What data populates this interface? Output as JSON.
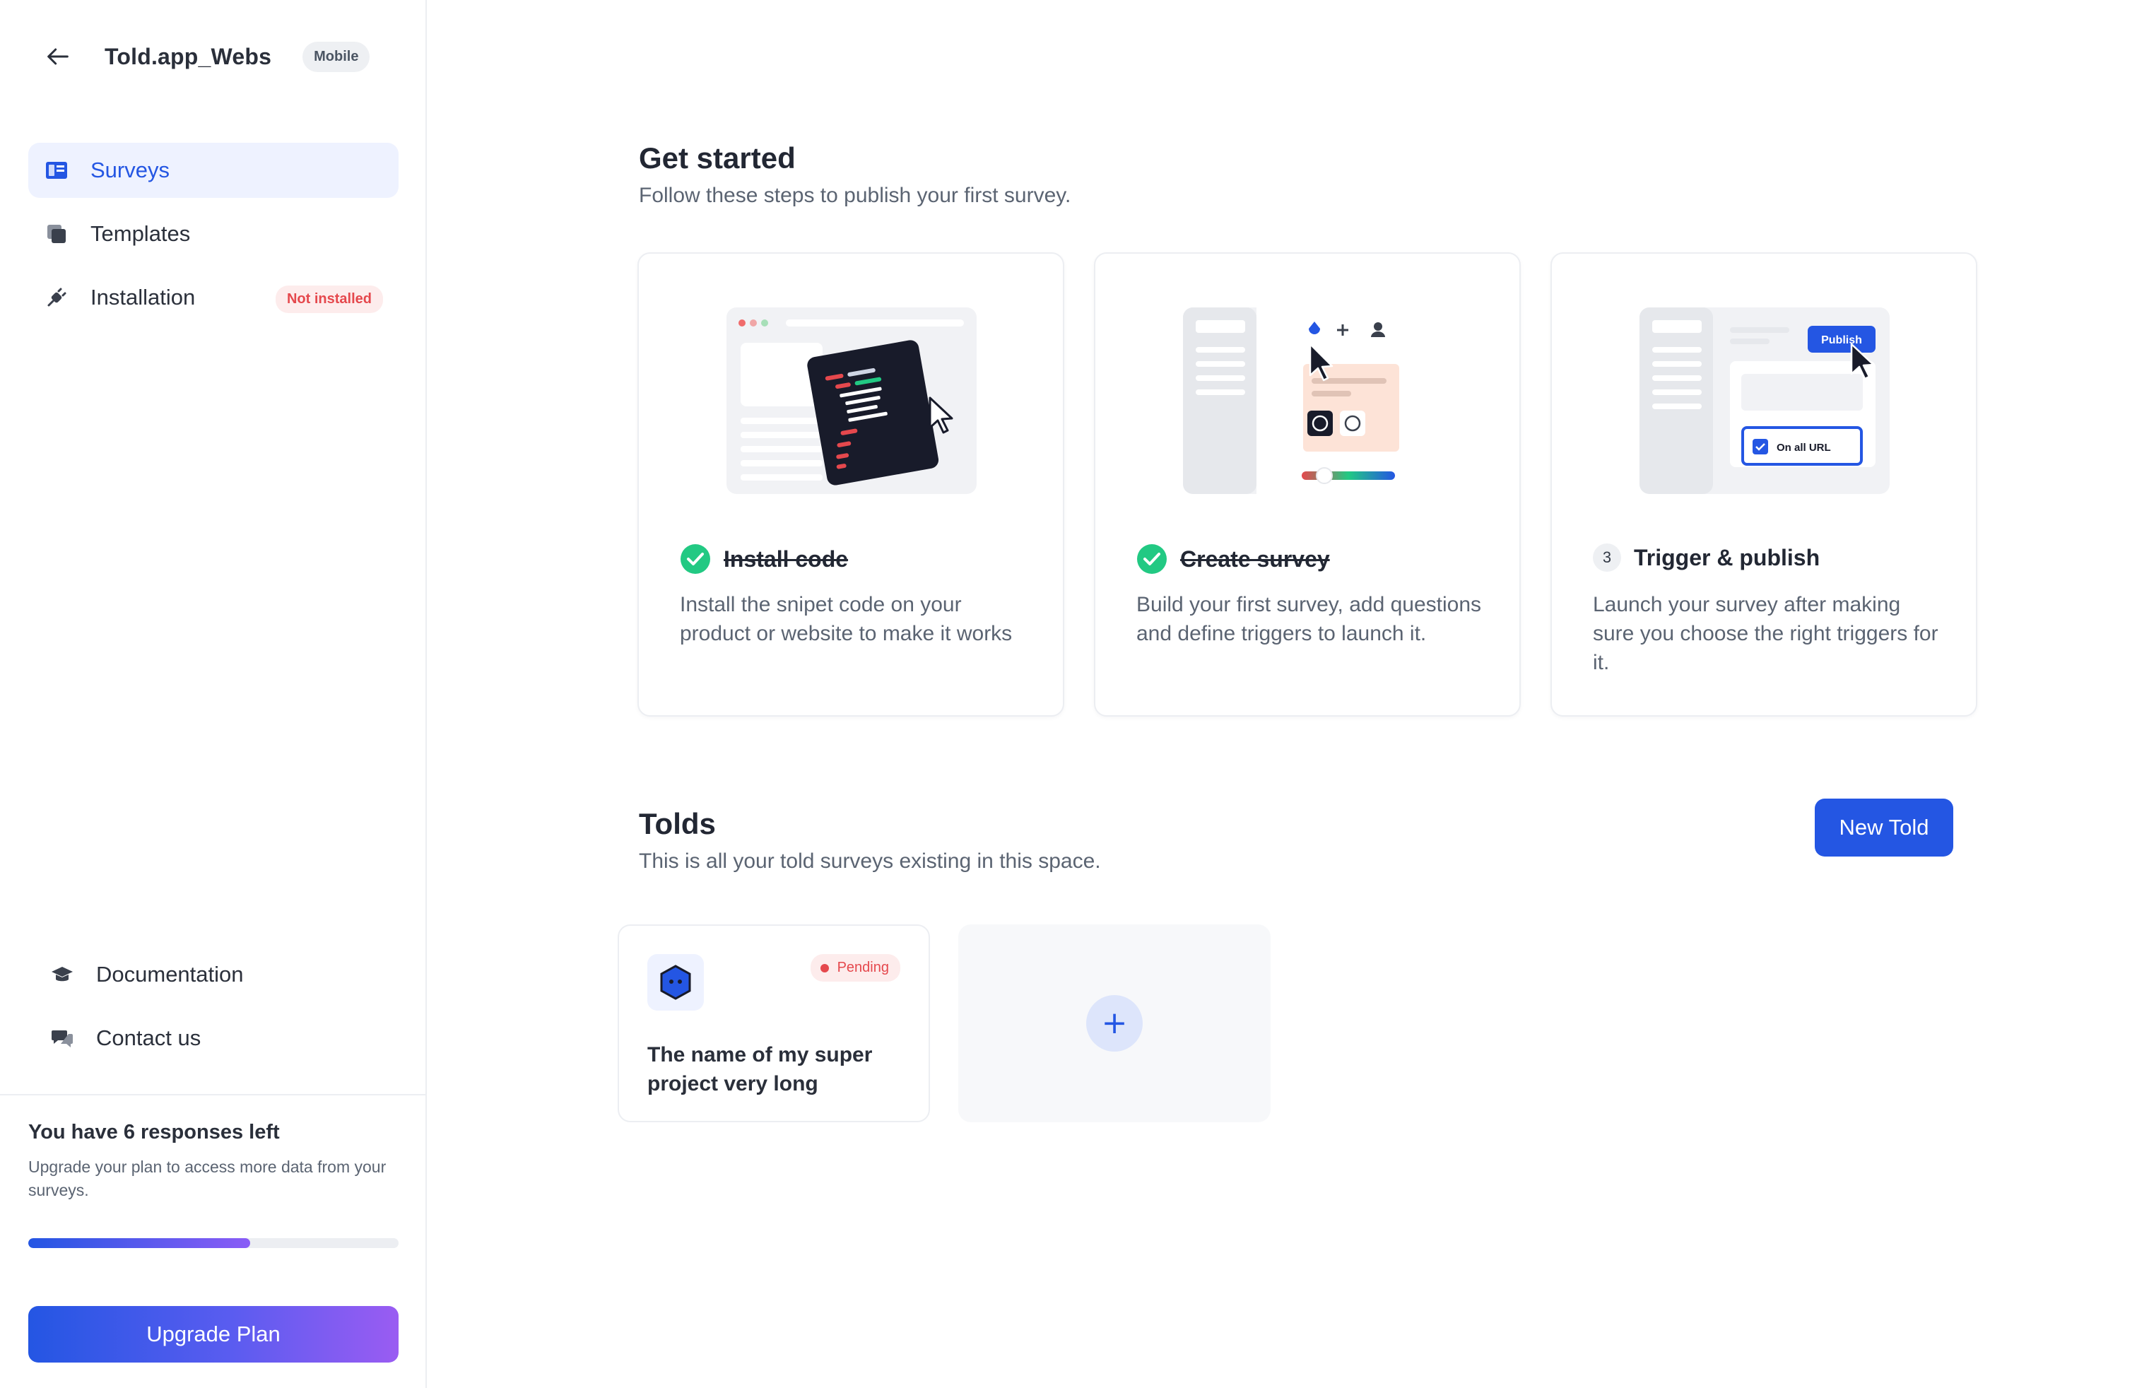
{
  "sidebar": {
    "workspace_name": "Told.app_Webs",
    "platform_badge": "Mobile",
    "nav": [
      {
        "label": "Surveys",
        "icon": "surveys-icon",
        "active": true
      },
      {
        "label": "Templates",
        "icon": "templates-icon"
      },
      {
        "label": "Installation",
        "icon": "plug-icon",
        "status": "Not installed"
      }
    ],
    "bottom_nav": [
      {
        "label": "Documentation",
        "icon": "graduation-cap-icon"
      },
      {
        "label": "Contact us",
        "icon": "chat-icon"
      }
    ],
    "usage": {
      "title": "You have 6 responses left",
      "description": "Upgrade your plan to access more data from your surveys.",
      "progress_fraction": 0.6
    },
    "upgrade_label": "Upgrade Plan"
  },
  "get_started": {
    "title": "Get started",
    "subtitle": "Follow these steps to publish your first survey.",
    "steps": [
      {
        "title": "Install code",
        "description": "Install the snipet code on your product or website to make it works",
        "done": true
      },
      {
        "title": "Create survey",
        "description": "Build your first survey, add questions and define triggers to launch it.",
        "done": true
      },
      {
        "number": "3",
        "title": "Trigger & publish",
        "description": "Launch your survey after making sure you choose the right triggers for it.",
        "done": false
      }
    ],
    "illustration_publish_label": "Publish",
    "illustration_url_label": "On all URL"
  },
  "tolds": {
    "title": "Tolds",
    "subtitle": "This is all your told surveys existing in this space.",
    "new_label": "New Told",
    "items": [
      {
        "name": "The name of my super project very long",
        "status": "Pending"
      }
    ],
    "add_label": "+"
  },
  "colors": {
    "accent": "#2456e3",
    "success": "#22c983",
    "danger": "#e5484d",
    "gradient_end": "#9a5cf2"
  }
}
